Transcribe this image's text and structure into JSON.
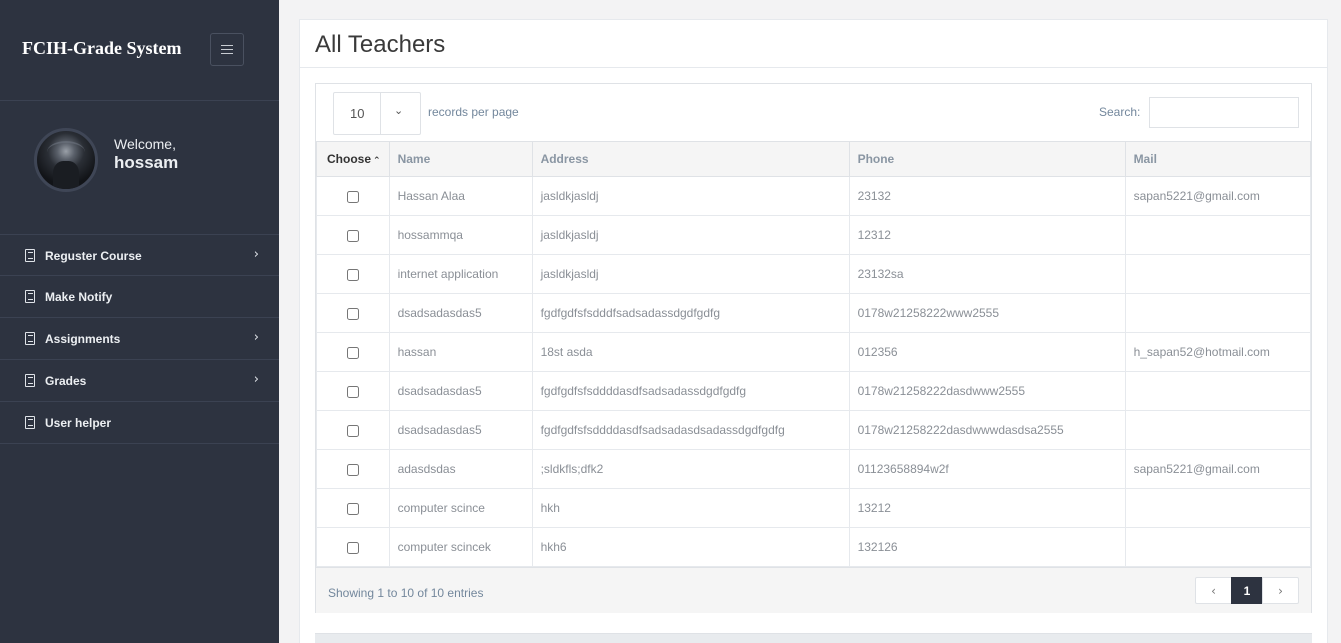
{
  "app": {
    "brand": "FCIH-Grade System"
  },
  "profile": {
    "welcome_label": "Welcome,",
    "username": "hossam"
  },
  "sidebar": {
    "items": [
      {
        "label": "Reguster Course",
        "has_children": true
      },
      {
        "label": "Make Notify",
        "has_children": false
      },
      {
        "label": "Assignments",
        "has_children": true
      },
      {
        "label": "Grades",
        "has_children": true
      },
      {
        "label": "User helper",
        "has_children": false
      }
    ]
  },
  "page": {
    "title": "All Teachers"
  },
  "table_controls": {
    "page_length": "10",
    "length_label": "records per page",
    "search_label": "Search:",
    "search_value": ""
  },
  "table": {
    "columns": [
      "Choose",
      "Name",
      "Address",
      "Phone",
      "Mail"
    ],
    "rows": [
      {
        "name": "Hassan Alaa",
        "address": "jasldkjasldj",
        "phone": "23132",
        "mail": "sapan5221@gmail.com"
      },
      {
        "name": "hossammqa",
        "address": "jasldkjasldj",
        "phone": "12312",
        "mail": ""
      },
      {
        "name": "internet application",
        "address": "jasldkjasldj",
        "phone": "23132sa",
        "mail": ""
      },
      {
        "name": "dsadsadasdas5",
        "address": "fgdfgdfsfsdddfsadsadassdgdfgdfg",
        "phone": "0178w21258222www2555",
        "mail": ""
      },
      {
        "name": "hassan",
        "address": "18st asda",
        "phone": "012356",
        "mail": "h_sapan52@hotmail.com"
      },
      {
        "name": "dsadsadasdas5",
        "address": "fgdfgdfsfsddddasdfsadsadassdgdfgdfg",
        "phone": "0178w21258222dasdwww2555",
        "mail": ""
      },
      {
        "name": "dsadsadasdas5",
        "address": "fgdfgdfsfsddddasdfsadsadasdsadassdgdfgdfg",
        "phone": "0178w21258222dasdwwwdasdsa2555",
        "mail": ""
      },
      {
        "name": "adasdsdas",
        "address": ";sldkfls;dfk2",
        "phone": "01123658894w2f",
        "mail": "sapan5221@gmail.com"
      },
      {
        "name": "computer scince",
        "address": "hkh",
        "phone": "13212",
        "mail": ""
      },
      {
        "name": "computer scincek",
        "address": "hkh6",
        "phone": "132126",
        "mail": ""
      }
    ]
  },
  "footer": {
    "info": "Showing 1 to 10 of 10 entries",
    "pager": {
      "prev": "‹",
      "current": "1",
      "next": "›"
    }
  },
  "icons": {
    "menu": "menu-icon",
    "nav_item": "document-icon",
    "chevron": "chevron-right-icon",
    "sort": "sort-ascending-icon"
  },
  "colors": {
    "sidebar": "#2d3340",
    "active_page": "#2d3340"
  }
}
